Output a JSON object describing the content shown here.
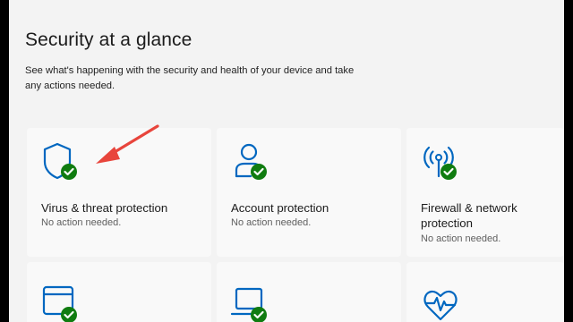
{
  "page": {
    "title": "Security at a glance",
    "description": "See what's happening with the security and health of your device and take any actions needed."
  },
  "accent_color": "#0067c0",
  "check_color": "#107c10",
  "annotation_color": "#e8453c",
  "tiles": [
    {
      "icon": "shield-icon",
      "title": "Virus & threat protection",
      "status": "No action needed."
    },
    {
      "icon": "account-icon",
      "title": "Account protection",
      "status": "No action needed."
    },
    {
      "icon": "wifi-antenna-icon",
      "title": "Firewall & network protection",
      "status": "No action needed."
    },
    {
      "icon": "app-browser-icon",
      "title": "",
      "status": ""
    },
    {
      "icon": "laptop-icon",
      "title": "",
      "status": ""
    },
    {
      "icon": "heart-pulse-icon",
      "title": "",
      "status": ""
    }
  ]
}
